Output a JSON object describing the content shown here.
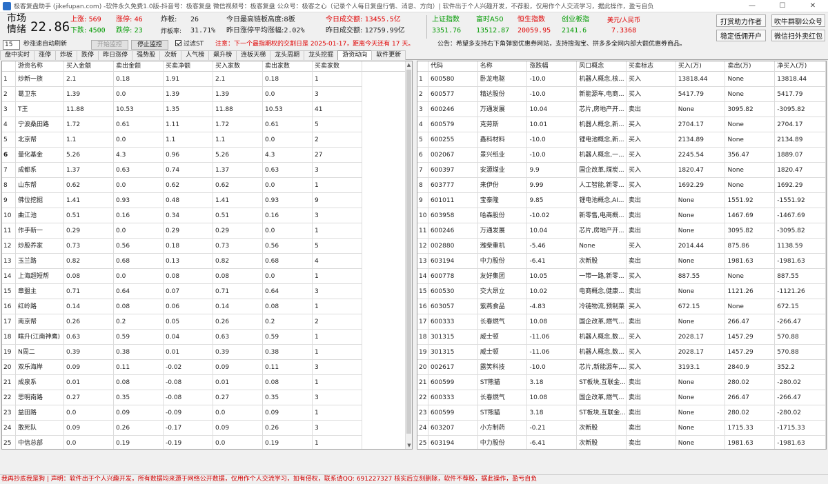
{
  "window": {
    "title": "极客复盘助手 (jikefupan.com) -软件永久免费1.0版-抖音号：极客复盘 微信视频号：极客复盘 公众号：极客之心（记录个人每日复盘行情、消息、方向）| 软件出于个人兴趣开发，不荐股，仅用作个人交流学习，据此操作，盈亏自负",
    "minimize": "—",
    "maximize": "☐",
    "close": "✕"
  },
  "header": {
    "sentiment_label_1": "市场",
    "sentiment_label_2": "情绪",
    "sentiment_value": "22.86",
    "up_label": "上涨:",
    "up_value": "569",
    "limit_up_label": "涨停:",
    "limit_up_value": "46",
    "down_label": "下跌:",
    "down_value": "4500",
    "limit_down_label": "跌停:",
    "limit_down_value": "23",
    "blowup_label": "炸板:",
    "blowup_value": "26",
    "blowup_rate_label": "炸板率:",
    "blowup_rate_value": "31.71%",
    "max_chain_label": "今日最高链板高度:",
    "max_chain_value": "8板",
    "yday_avg_label": "昨日涨停平均涨幅:",
    "yday_avg_value": "2.02%",
    "today_turnover_label": "今日成交额:",
    "today_turnover_value": "13455.5亿",
    "yday_turnover_label": "昨日成交额:",
    "yday_turnover_value": "12759.99亿",
    "indices": [
      {
        "name": "上证指数",
        "value": "3351.76",
        "color": "#009a00"
      },
      {
        "name": "富时A50",
        "value": "13512.87",
        "color": "#009a00"
      },
      {
        "name": "恒生指数",
        "value": "20059.95",
        "color": "#e00000"
      },
      {
        "name": "创业板指",
        "value": "2141.6",
        "color": "#009a00"
      },
      {
        "name": "美元/人民币",
        "value": "7.3368",
        "color": "#e00000"
      }
    ],
    "buttons": {
      "tip_author": "打赏助力作者",
      "stable_account": "稳定低佣开户",
      "wechat_official": "吹牛群聊公众号",
      "wechat_redpack": "微信扫外卖红包"
    }
  },
  "controls": {
    "interval_value": "15",
    "interval_label": "秒涨速自动刷新",
    "start_button": "开始监控",
    "stop_button": "停止监控",
    "filter_st_label": "过滤ST",
    "notice": "注意：下一个最指期权的交割日是 2025-01-17，距离今天还有 17 天。",
    "announcement": "公告：希望多支持右下角弹窗优惠券网站，支持搜淘宝、拼多多全网内部大额优惠券商品。"
  },
  "tabs": [
    "盘中实时",
    "涨停",
    "炸板",
    "跌停",
    "昨日涨停",
    "强势股",
    "次新",
    "人气榜",
    "飙升榜",
    "连板天梯",
    "龙头周期",
    "龙头挖掘",
    "游资动向",
    "软件更新"
  ],
  "active_tab_index": 12,
  "left_table": {
    "columns": [
      "",
      "游资名称",
      "买入金额",
      "卖出金额",
      "买卖净额",
      "买入家数",
      "卖出家数",
      "买卖家数"
    ],
    "rows": [
      [
        "1",
        "炒新一族",
        "2.1",
        "0.18",
        "1.91",
        "2.1",
        "0.18",
        "1"
      ],
      [
        "2",
        "葛卫东",
        "1.39",
        "0.0",
        "1.39",
        "1.39",
        "0.0",
        "3"
      ],
      [
        "3",
        "T王",
        "11.88",
        "10.53",
        "1.35",
        "11.88",
        "10.53",
        "41"
      ],
      [
        "4",
        "宁波桑田路",
        "1.72",
        "0.61",
        "1.11",
        "1.72",
        "0.61",
        "5"
      ],
      [
        "5",
        "北京帮",
        "1.1",
        "0.0",
        "1.1",
        "1.1",
        "0.0",
        "2"
      ],
      [
        "6",
        "量化基金",
        "5.26",
        "4.3",
        "0.96",
        "5.26",
        "4.3",
        "27"
      ],
      [
        "7",
        "成都系",
        "1.37",
        "0.63",
        "0.74",
        "1.37",
        "0.63",
        "3"
      ],
      [
        "8",
        "山东帮",
        "0.62",
        "0.0",
        "0.62",
        "0.62",
        "0.0",
        "1"
      ],
      [
        "9",
        "佛位挖掘",
        "1.41",
        "0.93",
        "0.48",
        "1.41",
        "0.93",
        "9"
      ],
      [
        "10",
        "曲江池",
        "0.51",
        "0.16",
        "0.34",
        "0.51",
        "0.16",
        "3"
      ],
      [
        "11",
        "作手新一",
        "0.29",
        "0.0",
        "0.29",
        "0.29",
        "0.0",
        "1"
      ],
      [
        "12",
        "炒股养家",
        "0.73",
        "0.56",
        "0.18",
        "0.73",
        "0.56",
        "5"
      ],
      [
        "13",
        "玉兰路",
        "0.82",
        "0.68",
        "0.13",
        "0.82",
        "0.68",
        "4"
      ],
      [
        "14",
        "上海超短帮",
        "0.08",
        "0.0",
        "0.08",
        "0.08",
        "0.0",
        "1"
      ],
      [
        "15",
        "章盟主",
        "0.71",
        "0.64",
        "0.07",
        "0.71",
        "0.64",
        "3"
      ],
      [
        "16",
        "红岭路",
        "0.14",
        "0.08",
        "0.06",
        "0.14",
        "0.08",
        "1"
      ],
      [
        "17",
        "南京帮",
        "0.26",
        "0.2",
        "0.05",
        "0.26",
        "0.2",
        "2"
      ],
      [
        "18",
        "瞎升(江南神鹰)",
        "0.63",
        "0.59",
        "0.04",
        "0.63",
        "0.59",
        "1"
      ],
      [
        "19",
        "N周二",
        "0.39",
        "0.38",
        "0.01",
        "0.39",
        "0.38",
        "1"
      ],
      [
        "20",
        "双乐海岸",
        "0.09",
        "0.11",
        "-0.02",
        "0.09",
        "0.11",
        "3"
      ],
      [
        "21",
        "成泉系",
        "0.01",
        "0.08",
        "-0.08",
        "0.01",
        "0.08",
        "1"
      ],
      [
        "22",
        "思明南路",
        "0.27",
        "0.35",
        "-0.08",
        "0.27",
        "0.35",
        "3"
      ],
      [
        "23",
        "益田路",
        "0.0",
        "0.09",
        "-0.09",
        "0.0",
        "0.09",
        "1"
      ],
      [
        "24",
        "敢死队",
        "0.09",
        "0.26",
        "-0.17",
        "0.09",
        "0.26",
        "3"
      ],
      [
        "25",
        "中信总部",
        "0.0",
        "0.19",
        "-0.19",
        "0.0",
        "0.19",
        "1"
      ]
    ]
  },
  "right_table": {
    "columns": [
      "",
      "代码",
      "名称",
      "涨跌幅",
      "风口概念",
      "买卖标志",
      "买入(万)",
      "卖出(万)",
      "净买入(万)"
    ],
    "rows": [
      [
        "1",
        "600580",
        "卧龙电驱",
        "-10.0",
        "机器人概念,核...",
        "买入",
        "13818.44",
        "None",
        "13818.44"
      ],
      [
        "2",
        "600577",
        "精达股份",
        "-10.0",
        "新能源车,电商...",
        "买入",
        "5417.79",
        "None",
        "5417.79"
      ],
      [
        "3",
        "600246",
        "万通发展",
        "10.04",
        "芯片,房地产开...",
        "卖出",
        "None",
        "3095.82",
        "-3095.82"
      ],
      [
        "4",
        "600579",
        "克劳斯",
        "10.01",
        "机器人概念,新...",
        "买入",
        "2704.17",
        "None",
        "2704.17"
      ],
      [
        "5",
        "600255",
        "鑫科材料",
        "-10.0",
        "锂电池概念,新...",
        "买入",
        "2134.89",
        "None",
        "2134.89"
      ],
      [
        "6",
        "002067",
        "景兴纸业",
        "-10.0",
        "机器人概念,一...",
        "买入",
        "2245.54",
        "356.47",
        "1889.07"
      ],
      [
        "7",
        "600397",
        "安源煤业",
        "9.9",
        "国企改革,煤炭...",
        "买入",
        "1820.47",
        "None",
        "1820.47"
      ],
      [
        "8",
        "603777",
        "来伊份",
        "9.99",
        "人工智能,新零...",
        "买入",
        "1692.29",
        "None",
        "1692.29"
      ],
      [
        "9",
        "601011",
        "宝泰隆",
        "9.85",
        "锂电池概念,AI...",
        "卖出",
        "None",
        "1551.92",
        "-1551.92"
      ],
      [
        "10",
        "603958",
        "哈森股份",
        "-10.02",
        "新零售,电商概...",
        "卖出",
        "None",
        "1467.69",
        "-1467.69"
      ],
      [
        "11",
        "600246",
        "万通发展",
        "10.04",
        "芯片,房地产开...",
        "卖出",
        "None",
        "3095.82",
        "-3095.82"
      ],
      [
        "12",
        "002880",
        "潍柴重机",
        "-5.46",
        "None",
        "买入",
        "2014.44",
        "875.86",
        "1138.59"
      ],
      [
        "13",
        "603194",
        "中力股份",
        "-6.41",
        "次新股",
        "卖出",
        "None",
        "1981.63",
        "-1981.63"
      ],
      [
        "14",
        "600778",
        "友好集团",
        "10.05",
        "一带一路,新零...",
        "买入",
        "887.55",
        "None",
        "887.55"
      ],
      [
        "15",
        "600530",
        "交大昂立",
        "10.02",
        "电商概念,健康...",
        "卖出",
        "None",
        "1121.26",
        "-1121.26"
      ],
      [
        "16",
        "603057",
        "紫燕食品",
        "-4.83",
        "冷链物流,预制菜",
        "买入",
        "672.15",
        "None",
        "672.15"
      ],
      [
        "17",
        "600333",
        "长春燃气",
        "10.08",
        "国企改革,燃气...",
        "卖出",
        "None",
        "266.47",
        "-266.47"
      ],
      [
        "18",
        "301315",
        "威士顿",
        "-11.06",
        "机器人概念,数...",
        "买入",
        "2028.17",
        "1457.29",
        "570.88"
      ],
      [
        "19",
        "301315",
        "威士顿",
        "-11.06",
        "机器人概念,数...",
        "买入",
        "2028.17",
        "1457.29",
        "570.88"
      ],
      [
        "20",
        "002617",
        "露笑科技",
        "-10.0",
        "芯片,新能源车,...",
        "买入",
        "3193.1",
        "2840.9",
        "352.2"
      ],
      [
        "21",
        "600599",
        "ST熊猫",
        "3.18",
        "ST板块,互联金...",
        "卖出",
        "None",
        "280.02",
        "-280.02"
      ],
      [
        "22",
        "600333",
        "长春燃气",
        "10.08",
        "国企改革,燃气...",
        "卖出",
        "None",
        "266.47",
        "-266.47"
      ],
      [
        "23",
        "600599",
        "ST熊猫",
        "3.18",
        "ST板块,互联金...",
        "卖出",
        "None",
        "280.02",
        "-280.02"
      ],
      [
        "24",
        "603207",
        "小方制药",
        "-0.21",
        "次新股",
        "卖出",
        "None",
        "1715.33",
        "-1715.33"
      ],
      [
        "25",
        "603194",
        "中力股份",
        "-6.41",
        "次新股",
        "卖出",
        "None",
        "1981.63",
        "-1981.63"
      ]
    ]
  },
  "footer": {
    "text": "我再抄底我是狗 | 声明：软件出于个人兴趣开发，所有数据均来源于网络公开数据，仅用作个人交流学习，如有侵权，联系请QQ: 691227327 核实后立刻删除，软件不荐股，据此操作，盈亏自负"
  }
}
